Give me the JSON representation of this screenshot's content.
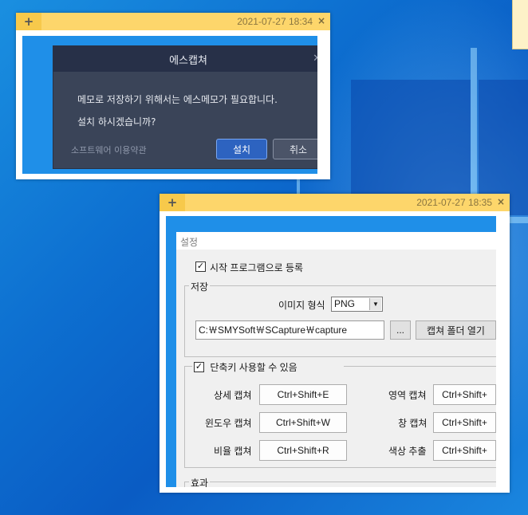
{
  "note1": {
    "add_icon": "+",
    "timestamp": "2021-07-27 18:34",
    "close_icon": "×",
    "dialog": {
      "title": "에스캡쳐",
      "message_line1": "메모로 저장하기 위해서는 에스메모가 필요합니다.",
      "message_line2": "설치 하시겠습니까?",
      "terms_link": "소프트웨어 이용약관",
      "install_button": "설치",
      "cancel_button": "취소"
    }
  },
  "note2": {
    "add_icon": "+",
    "timestamp": "2021-07-27 18:35",
    "close_icon": "×",
    "settings": {
      "title": "설정",
      "startup_label": "시작 프로그램으로 등록",
      "startup_checked": true,
      "save_group": {
        "title": "저장",
        "image_format_label": "이미지 형식",
        "image_format_value": "PNG",
        "path_value": "C:￦SMYSoft￦SCapture￦capture",
        "browse_button": "...",
        "open_folder_button": "캡쳐 폴더 열기"
      },
      "hotkey_group": {
        "title": "단축키 사용할 수 있음",
        "checked": true,
        "rows": [
          {
            "left_label": "상세 캡쳐",
            "left_key": "Ctrl+Shift+E",
            "right_label": "영역 캡쳐",
            "right_key": "Ctrl+Shift+"
          },
          {
            "left_label": "윈도우 캡쳐",
            "left_key": "Ctrl+Shift+W",
            "right_label": "창 캡쳐",
            "right_key": "Ctrl+Shift+"
          },
          {
            "left_label": "비율 캡쳐",
            "left_key": "Ctrl+Shift+R",
            "right_label": "색상 추출",
            "right_key": "Ctrl+Shift+"
          }
        ]
      },
      "effect_group": {
        "title": "효과"
      }
    }
  }
}
